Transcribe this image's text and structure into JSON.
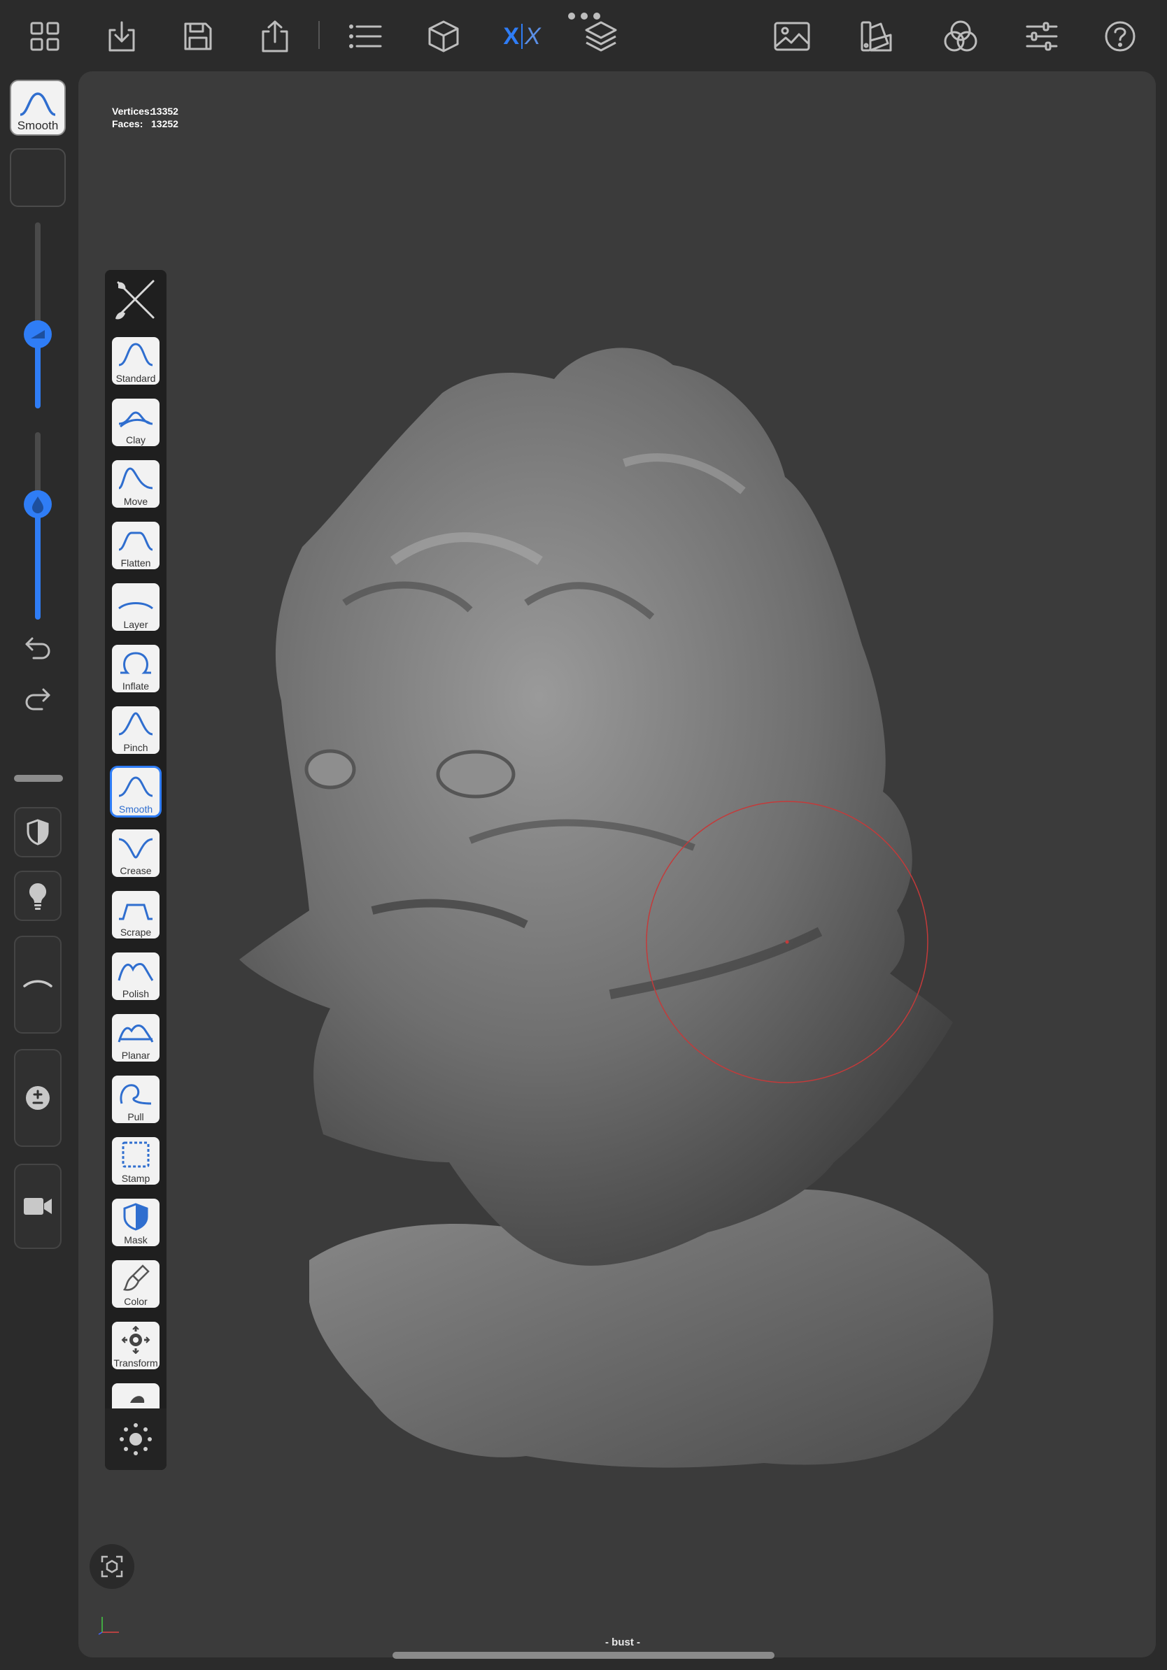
{
  "toolbar": {
    "left_icons": [
      "grid-icon",
      "download-icon",
      "save-icon",
      "share-icon",
      "list-icon",
      "cube-icon",
      "symmetry-icon",
      "layers-icon"
    ],
    "right_icons": [
      "image-icon",
      "palette-icon",
      "materials-icon",
      "settings-sliders-icon",
      "help-icon"
    ],
    "symmetry_label_left": "X",
    "symmetry_label_right": "X",
    "accent_color": "#2f7df6"
  },
  "current_tool": {
    "label": "Smooth",
    "icon": "smooth-curve-icon"
  },
  "sliders": {
    "radius": {
      "value_fraction": 0.41
    },
    "intensity": {
      "value_fraction": 0.62
    }
  },
  "stats": {
    "vertices_label": "Vertices:",
    "vertices_value": "13352",
    "faces_label": "Faces:",
    "faces_value": "13252"
  },
  "brushes": [
    {
      "label": "Standard",
      "icon": "standard-curve-icon"
    },
    {
      "label": "Clay",
      "icon": "clay-curve-icon"
    },
    {
      "label": "Move",
      "icon": "move-curve-icon"
    },
    {
      "label": "Flatten",
      "icon": "flatten-curve-icon"
    },
    {
      "label": "Layer",
      "icon": "layer-curve-icon"
    },
    {
      "label": "Inflate",
      "icon": "inflate-curve-icon"
    },
    {
      "label": "Pinch",
      "icon": "pinch-curve-icon"
    },
    {
      "label": "Smooth",
      "icon": "smooth-curve-icon",
      "selected": true
    },
    {
      "label": "Crease",
      "icon": "crease-curve-icon"
    },
    {
      "label": "Scrape",
      "icon": "scrape-curve-icon"
    },
    {
      "label": "Polish",
      "icon": "polish-curve-icon"
    },
    {
      "label": "Planar",
      "icon": "planar-curve-icon"
    },
    {
      "label": "Pull",
      "icon": "pull-curve-icon"
    },
    {
      "label": "Stamp",
      "icon": "stamp-icon"
    },
    {
      "label": "Mask",
      "icon": "mask-icon"
    },
    {
      "label": "Color",
      "icon": "color-brush-icon"
    },
    {
      "label": "Transform",
      "icon": "transform-icon"
    }
  ],
  "object_name": "- bust -"
}
